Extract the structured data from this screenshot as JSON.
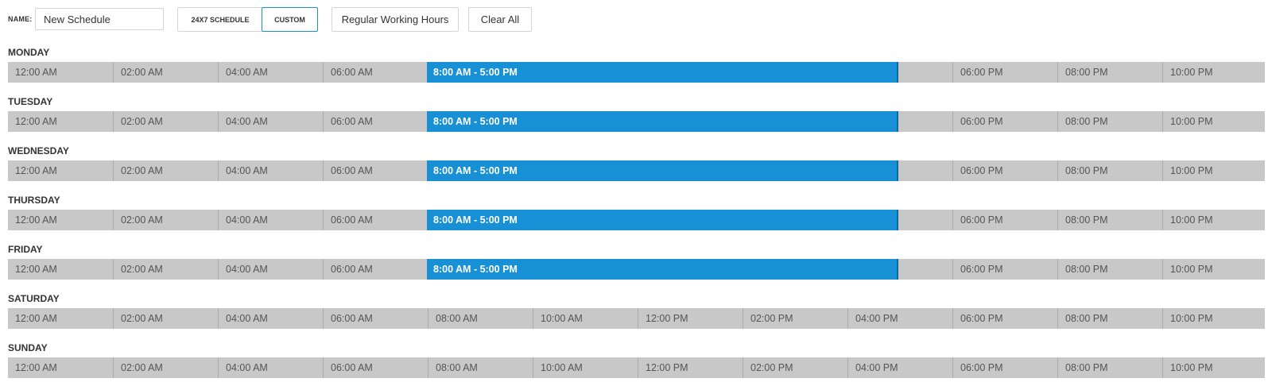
{
  "toolbar": {
    "name_label": "NAME:",
    "name_value": "New Schedule",
    "mode_24x7": "24X7 SCHEDULE",
    "mode_custom": "CUSTOM",
    "regular_hours": "Regular Working Hours",
    "clear_all": "Clear All",
    "accent_color": "#1a8fd6"
  },
  "colors": {
    "track": "#c8c8c8",
    "block": "#1790d5"
  },
  "days": [
    {
      "name": "MONDAY",
      "block": "8:00 AM - 5:00 PM",
      "slots": [
        "12:00 AM",
        "02:00 AM",
        "04:00 AM",
        "06:00 AM",
        "06:00 PM",
        "08:00 PM",
        "10:00 PM"
      ]
    },
    {
      "name": "TUESDAY",
      "block": "8:00 AM - 5:00 PM",
      "slots": [
        "12:00 AM",
        "02:00 AM",
        "04:00 AM",
        "06:00 AM",
        "06:00 PM",
        "08:00 PM",
        "10:00 PM"
      ]
    },
    {
      "name": "WEDNESDAY",
      "block": "8:00 AM - 5:00 PM",
      "slots": [
        "12:00 AM",
        "02:00 AM",
        "04:00 AM",
        "06:00 AM",
        "06:00 PM",
        "08:00 PM",
        "10:00 PM"
      ]
    },
    {
      "name": "THURSDAY",
      "block": "8:00 AM - 5:00 PM",
      "slots": [
        "12:00 AM",
        "02:00 AM",
        "04:00 AM",
        "06:00 AM",
        "06:00 PM",
        "08:00 PM",
        "10:00 PM"
      ]
    },
    {
      "name": "FRIDAY",
      "block": "8:00 AM - 5:00 PM",
      "slots": [
        "12:00 AM",
        "02:00 AM",
        "04:00 AM",
        "06:00 AM",
        "06:00 PM",
        "08:00 PM",
        "10:00 PM"
      ]
    },
    {
      "name": "SATURDAY",
      "block": null,
      "slots": [
        "12:00 AM",
        "02:00 AM",
        "04:00 AM",
        "06:00 AM",
        "08:00 AM",
        "10:00 AM",
        "12:00 PM",
        "02:00 PM",
        "04:00 PM",
        "06:00 PM",
        "08:00 PM",
        "10:00 PM"
      ]
    },
    {
      "name": "SUNDAY",
      "block": null,
      "slots": [
        "12:00 AM",
        "02:00 AM",
        "04:00 AM",
        "06:00 AM",
        "08:00 AM",
        "10:00 AM",
        "12:00 PM",
        "02:00 PM",
        "04:00 PM",
        "06:00 PM",
        "08:00 PM",
        "10:00 PM"
      ]
    }
  ]
}
